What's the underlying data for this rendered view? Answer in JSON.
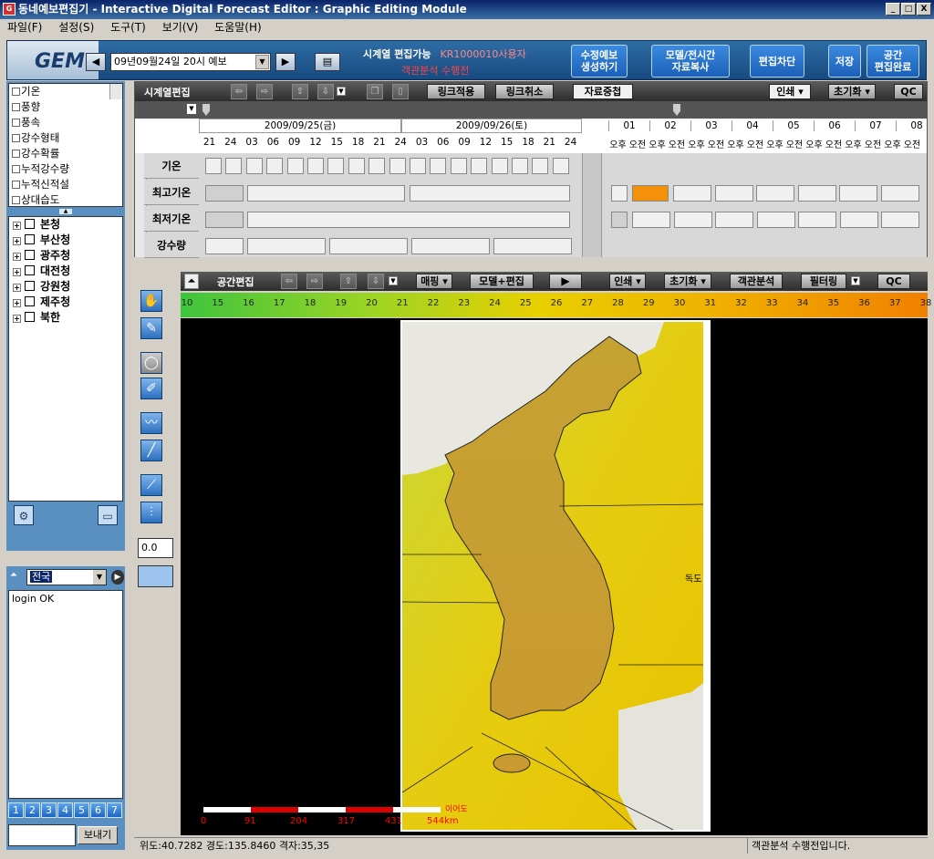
{
  "window": {
    "title": "동네예보편집기 - Interactive Digital Forecast Editor : Graphic Editing Module",
    "icon_text": "G",
    "controls": [
      "_",
      "□",
      "X"
    ]
  },
  "menu": [
    "파일(F)",
    "설정(S)",
    "도구(T)",
    "보기(V)",
    "도움말(H)"
  ],
  "toolbar": {
    "logo": "GEM",
    "forecast_select": "09년09월24일 20시 예보",
    "status_main": "시계열 편집가능",
    "status_overlay": "KR1000010사용자",
    "status_red": "객관분석 수행전",
    "buttons": [
      {
        "label": "수정예보\n생성하기"
      },
      {
        "label": "모델/전시간\n자료복사"
      },
      {
        "label": "편집차단"
      },
      {
        "label": "저장"
      },
      {
        "label": "공간\n편집완료"
      }
    ]
  },
  "variables": [
    "기온",
    "풍향",
    "풍속",
    "강수형태",
    "강수확률",
    "누적강수량",
    "누적신적설",
    "상대습도"
  ],
  "regions": [
    "본청",
    "부산청",
    "광주청",
    "대전청",
    "강원청",
    "제주청",
    "북한"
  ],
  "log": {
    "selected": "전국",
    "lines": [
      "login OK"
    ],
    "pages": [
      "1",
      "2",
      "3",
      "4",
      "5",
      "6",
      "7"
    ],
    "send_label": "보내기"
  },
  "timeseries": {
    "title": "시계열편집",
    "btn_link_apply": "링크적용",
    "btn_link_cancel": "링크취소",
    "btn_data_overlay": "자료중첩",
    "btn_print": "인쇄",
    "btn_init": "초기화",
    "btn_qc": "QC",
    "dates": [
      "2009/09/25(금)",
      "2009/09/26(토)"
    ],
    "hours": [
      "21",
      "24",
      "03",
      "06",
      "09",
      "12",
      "15",
      "18",
      "21",
      "24",
      "03",
      "06",
      "09",
      "12",
      "15",
      "18",
      "21",
      "24"
    ],
    "days": [
      "01",
      "02",
      "03",
      "04",
      "05",
      "06",
      "07",
      "08"
    ],
    "ampm": [
      "오후",
      "오전",
      "오후",
      "오전",
      "오후",
      "오전",
      "오후",
      "오전",
      "오후",
      "오전",
      "오후",
      "오전",
      "오후",
      "오전",
      "오후",
      "오전"
    ],
    "rows": [
      "기온",
      "최고기온",
      "최저기온",
      "강수량"
    ]
  },
  "spatial": {
    "title": "공간편집",
    "btn_mapping": "매핑",
    "btn_model_edit": "모델+편집",
    "btn_print": "인쇄",
    "btn_init": "초기화",
    "btn_obj_analysis": "객관분석",
    "btn_filtering": "필터링",
    "btn_qc": "QC",
    "scale_ticks": [
      "10",
      "15",
      "16",
      "17",
      "18",
      "19",
      "20",
      "21",
      "22",
      "23",
      "24",
      "25",
      "26",
      "27",
      "28",
      "29",
      "30",
      "31",
      "32",
      "33",
      "34",
      "35",
      "36",
      "37",
      "38"
    ],
    "label_dokdo": "독도",
    "label_ieodo": "이어도",
    "distance_ticks": [
      "0",
      "91",
      "204",
      "317",
      "431",
      "544km"
    ],
    "value": "0.0",
    "colors": {
      "cold": "#3ec43e",
      "mid": "#e8d000",
      "warm": "#f08000"
    }
  },
  "statusbar": {
    "coords": "위도:40.7282 경도:135.8460 격자:35,35",
    "message": "객관분석 수행전입니다."
  }
}
